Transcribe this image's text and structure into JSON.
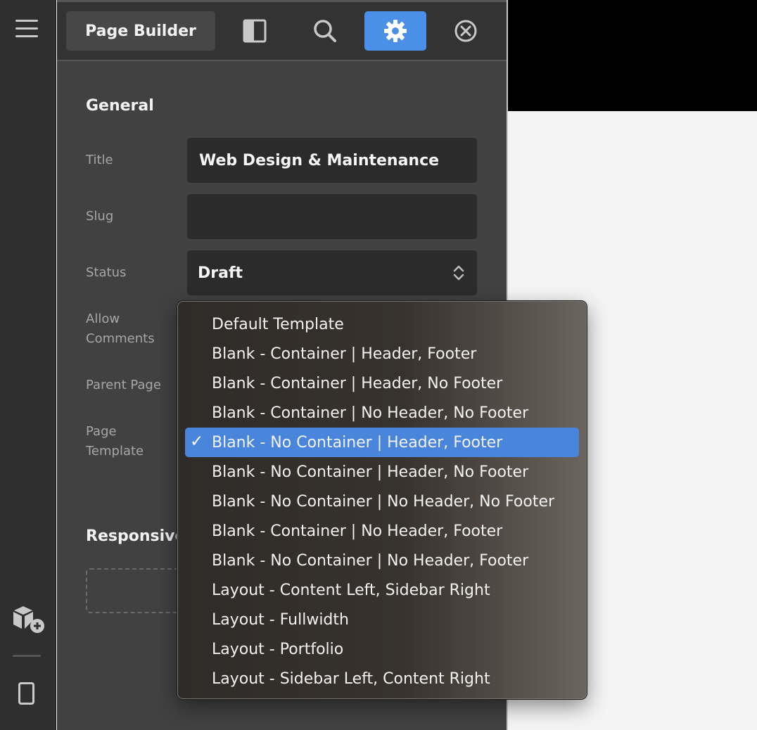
{
  "toolbar": {
    "title": "Page Builder",
    "icons": [
      "layout-panel-icon",
      "search-icon",
      "gear-icon",
      "close-circle-icon"
    ],
    "active_icon": "gear-icon",
    "accent_color": "#4a90e8"
  },
  "general": {
    "heading": "General",
    "title_label": "Title",
    "title_value": "Web Design & Maintenance",
    "slug_label": "Slug",
    "slug_value": "",
    "status_label": "Status",
    "status_value": "Draft",
    "allow_comments_label_1": "Allow",
    "allow_comments_label_2": "Comments",
    "parent_page_label": "Parent Page",
    "page_template_label_1": "Page",
    "page_template_label_2": "Template"
  },
  "responsive": {
    "heading": "Responsive"
  },
  "template_menu": {
    "options": [
      "Default Template",
      "Blank - Container | Header, Footer",
      "Blank - Container | Header, No Footer",
      "Blank - Container | No Header, No Footer",
      "Blank - No Container | Header, Footer",
      "Blank - No Container | Header, No Footer",
      "Blank - No Container | No Header, No Footer",
      "Blank - Container | No Header, Footer",
      "Blank - No Container | No Header, Footer",
      "Layout - Content Left, Sidebar Right",
      "Layout - Fullwidth",
      "Layout - Portfolio",
      "Layout - Sidebar Left, Content Right"
    ],
    "selected_index": 4,
    "check_glyph": "✓",
    "highlight_color": "#4a85dc"
  }
}
